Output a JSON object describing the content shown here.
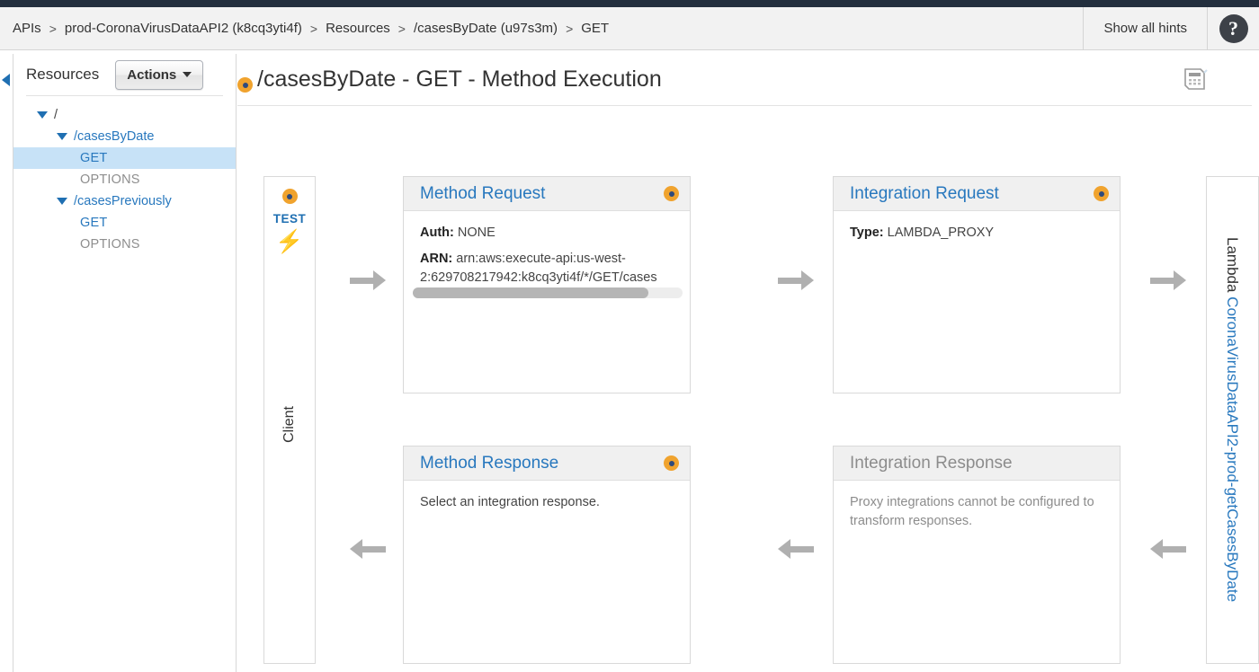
{
  "breadcrumb": {
    "items": [
      "APIs",
      "prod-CoronaVirusDataAPI2 (k8cq3yti4f)",
      "Resources",
      "/casesByDate (u97s3m)",
      "GET"
    ],
    "separator": ">",
    "show_hints_label": "Show all hints",
    "help_glyph": "?"
  },
  "sidebar": {
    "title": "Resources",
    "actions_label": "Actions",
    "tree": [
      {
        "label": "/",
        "type": "root",
        "expanded": true,
        "indent": 0
      },
      {
        "label": "/casesByDate",
        "type": "resource",
        "expanded": true,
        "indent": 1
      },
      {
        "label": "GET",
        "type": "method",
        "selected": true,
        "indent": 2
      },
      {
        "label": "OPTIONS",
        "type": "method",
        "selected": false,
        "indent": 2
      },
      {
        "label": "/casesPreviously",
        "type": "resource",
        "expanded": true,
        "indent": 1
      },
      {
        "label": "GET",
        "type": "method",
        "selected": false,
        "indent": 2
      },
      {
        "label": "OPTIONS",
        "type": "method",
        "selected": false,
        "indent": 2
      }
    ]
  },
  "page": {
    "title": "/casesByDate - GET - Method Execution"
  },
  "diagram": {
    "client": {
      "test_label": "TEST",
      "bolt_glyph": "⚡",
      "vertical_label": "Client"
    },
    "lambda": {
      "word": "Lambda ",
      "function_name": "CoronaVirusDataAPI2-prod-getCasesByDate"
    },
    "method_request": {
      "title": "Method Request",
      "auth_label": "Auth:",
      "auth_value": "NONE",
      "arn_label": "ARN:",
      "arn_value": "arn:aws:execute-api:us-west-2:629708217942:k8cq3yti4f/*/GET/cases"
    },
    "integration_request": {
      "title": "Integration Request",
      "type_label": "Type:",
      "type_value": "LAMBDA_PROXY"
    },
    "method_response": {
      "title": "Method Response",
      "body": "Select an integration response."
    },
    "integration_response": {
      "title": "Integration Response",
      "body": "Proxy integrations cannot be configured to transform responses."
    }
  },
  "colors": {
    "accent_blue": "#2878be",
    "hint_orange": "#f0a32e",
    "navy": "#232f3e",
    "selected_row": "#c7e2f7",
    "arrow_grey": "#b0b0b0"
  }
}
